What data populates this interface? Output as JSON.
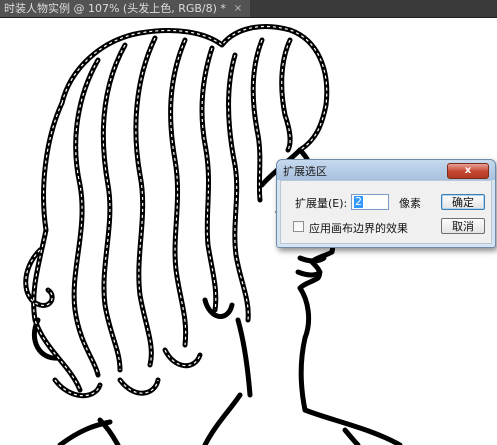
{
  "document_tab": {
    "title": "时装人物实例 @ 107% (头发上色, RGB/8) *",
    "close_glyph": "×"
  },
  "dialog": {
    "title": "扩展选区",
    "close_glyph": "x",
    "expand_label": "扩展量(E):",
    "expand_value": "2",
    "unit": "像素",
    "ok_label": "确定",
    "cancel_label": "取消",
    "checkbox_label": "应用画布边界的效果",
    "checkbox_checked": false
  },
  "colors": {
    "annotation_arrow": "#e0241b",
    "dialog_chrome": "#d6e3f1",
    "input_highlight": "#3399ff"
  }
}
